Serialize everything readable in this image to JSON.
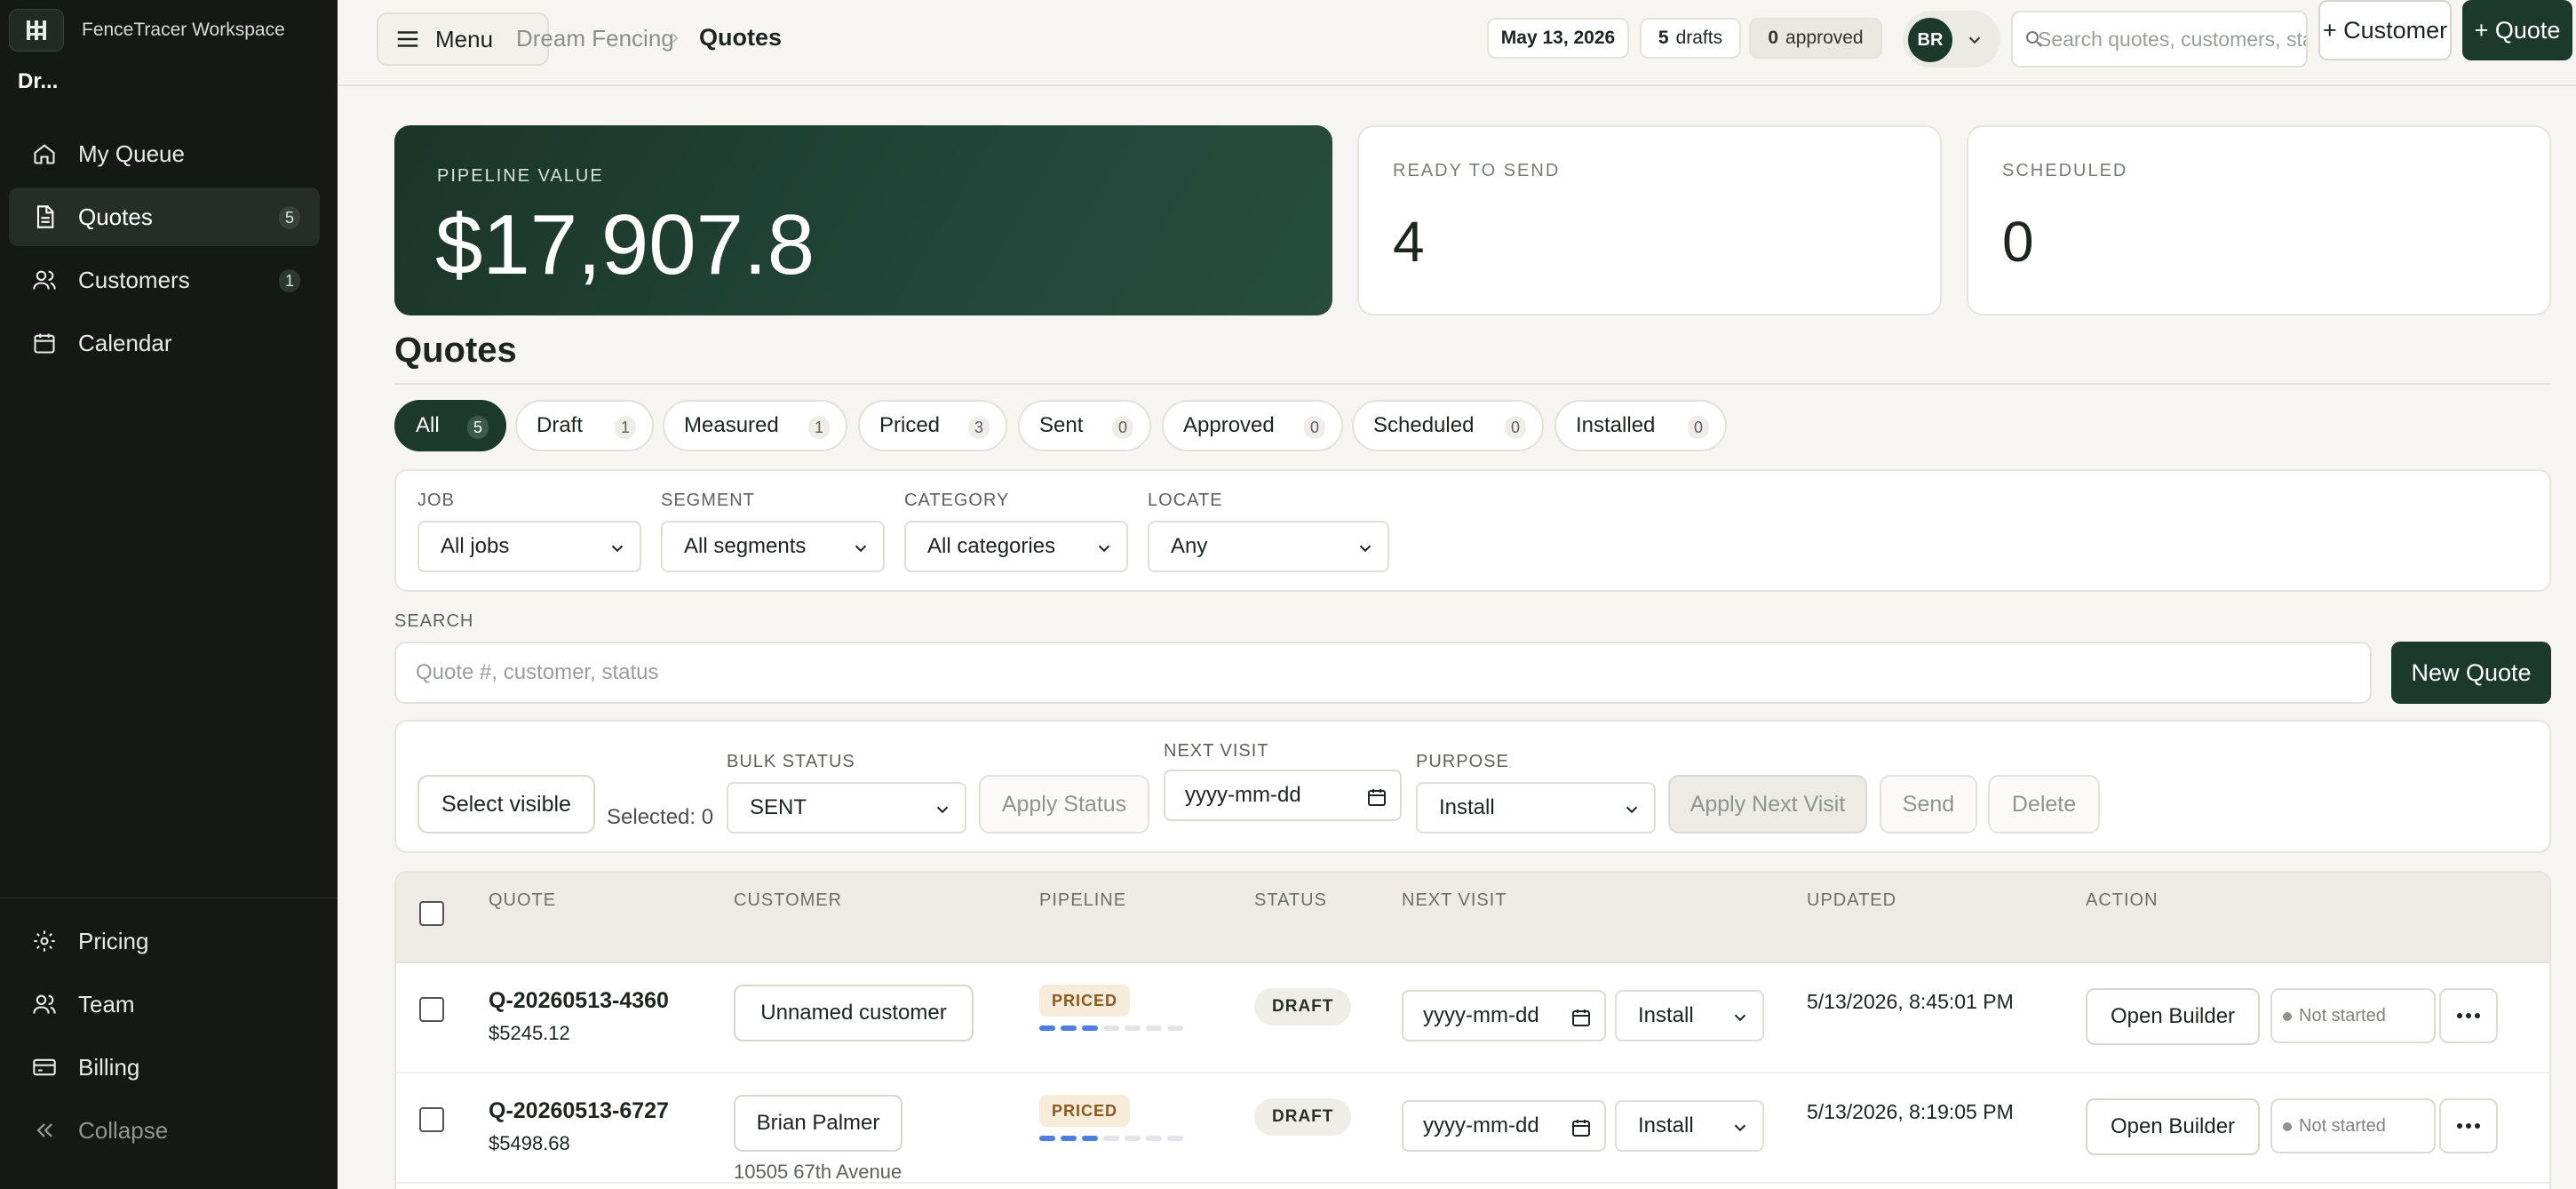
{
  "sidebar": {
    "workspace": "FenceTracer Workspace",
    "org": "Dr...",
    "items": [
      {
        "label": "My Queue",
        "count": ""
      },
      {
        "label": "Quotes",
        "count": "5"
      },
      {
        "label": "Customers",
        "count": "1"
      },
      {
        "label": "Calendar",
        "count": ""
      }
    ],
    "bottom": [
      {
        "label": "Pricing"
      },
      {
        "label": "Team"
      },
      {
        "label": "Billing"
      },
      {
        "label": "Collapse"
      }
    ]
  },
  "topbar": {
    "menu_label": "Menu",
    "breadcrumb": [
      "Dream Fencing",
      "Quotes"
    ],
    "date": "May 13, 2026",
    "drafts_count": "5",
    "drafts_label": "drafts",
    "approved_count": "0",
    "approved_label": "approved",
    "avatar_initials": "BR",
    "search_placeholder": "Search quotes, customers, status",
    "add_customer": "+ Customer",
    "add_quote": "+ Quote"
  },
  "stats": {
    "pipeline_label": "PIPELINE VALUE",
    "pipeline_value": "$17,907.8",
    "ready_label": "READY TO SEND",
    "ready_value": "4",
    "scheduled_label": "SCHEDULED",
    "scheduled_value": "0"
  },
  "section_title": "Quotes",
  "tabs": [
    {
      "label": "All",
      "count": "5"
    },
    {
      "label": "Draft",
      "count": "1"
    },
    {
      "label": "Measured",
      "count": "1"
    },
    {
      "label": "Priced",
      "count": "3"
    },
    {
      "label": "Sent",
      "count": "0"
    },
    {
      "label": "Approved",
      "count": "0"
    },
    {
      "label": "Scheduled",
      "count": "0"
    },
    {
      "label": "Installed",
      "count": "0"
    }
  ],
  "filters": {
    "job_label": "JOB",
    "job_value": "All jobs",
    "segment_label": "SEGMENT",
    "segment_value": "All segments",
    "category_label": "CATEGORY",
    "category_value": "All categories",
    "locate_label": "LOCATE",
    "locate_value": "Any"
  },
  "search": {
    "label": "SEARCH",
    "placeholder": "Quote #, customer, status",
    "new_quote": "New Quote"
  },
  "bulk": {
    "select_visible": "Select visible",
    "selected": "Selected: 0",
    "bulk_status_label": "BULK STATUS",
    "bulk_status_value": "SENT",
    "apply_status": "Apply Status",
    "next_visit_label": "NEXT VISIT",
    "next_visit_placeholder": "yyyy-mm-dd",
    "purpose_label": "PURPOSE",
    "purpose_value": "Install",
    "apply_next_visit": "Apply Next Visit",
    "send": "Send",
    "delete": "Delete"
  },
  "table": {
    "headers": [
      "QUOTE",
      "CUSTOMER",
      "PIPELINE",
      "STATUS",
      "NEXT VISIT",
      "UPDATED",
      "ACTION"
    ],
    "rows": [
      {
        "id": "Q-20260513-4360",
        "amount": "$5245.12",
        "customer": "Unnamed customer",
        "address": "",
        "pipeline": "PRICED",
        "pipeline_progress": 3,
        "pipeline_steps": 7,
        "status": "DRAFT",
        "next_visit": "yyyy-mm-dd",
        "purpose": "Install",
        "updated": "5/13/2026, 8:45:01 PM",
        "action": "Open Builder",
        "progress": "Not started"
      },
      {
        "id": "Q-20260513-6727",
        "amount": "$5498.68",
        "customer": "Brian Palmer",
        "address": "10505 67th Avenue",
        "pipeline": "PRICED",
        "pipeline_progress": 3,
        "pipeline_steps": 7,
        "status": "DRAFT",
        "next_visit": "yyyy-mm-dd",
        "purpose": "Install",
        "updated": "5/13/2026, 8:19:05 PM",
        "action": "Open Builder",
        "progress": "Not started"
      }
    ]
  }
}
